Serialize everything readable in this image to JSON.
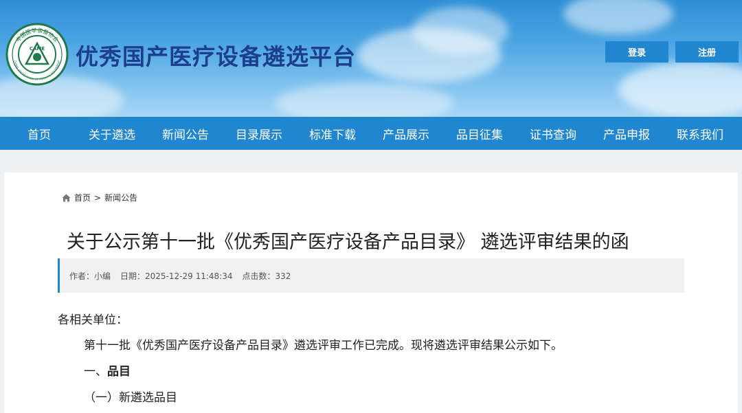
{
  "site": {
    "title": "优秀国产医疗设备遴选平台",
    "logo": {
      "ring_text_top": "中国医学装备协会",
      "center_text": "CAME",
      "ring_text_bottom": "CHINA ASSOCIATION OF MEDICAL EQUIPMENT",
      "icon": "came-logo-emblem"
    }
  },
  "header_buttons": {
    "login": "登录",
    "register": "注册"
  },
  "nav": {
    "items": [
      "首页",
      "关于遴选",
      "新闻公告",
      "目录展示",
      "标准下载",
      "产品展示",
      "品目征集",
      "证书查询",
      "产品申报",
      "联系我们"
    ]
  },
  "breadcrumb": {
    "home": "首页",
    "separator": ">",
    "current": "新闻公告"
  },
  "article": {
    "title": "关于公示第十一批《优秀国产医疗设备产品目录》 遴选评审结果的函",
    "meta": {
      "author": "作者：小编",
      "date": "日期：2025-12-29 11:48:34",
      "views": "点击数：332"
    },
    "salutation": "各相关单位：",
    "body": "第十一批《优秀国产医疗设备产品目录》遴选评审工作已完成。现将遴选评审结果公示如下。",
    "section1_prefix": "一、",
    "section1_title": "品目",
    "subsection1": "（一）新遴选品目"
  },
  "colors": {
    "primary_blue": "#1f86cf",
    "title_navy": "#1c3f8c",
    "meta_bg": "#f1f1f1"
  }
}
